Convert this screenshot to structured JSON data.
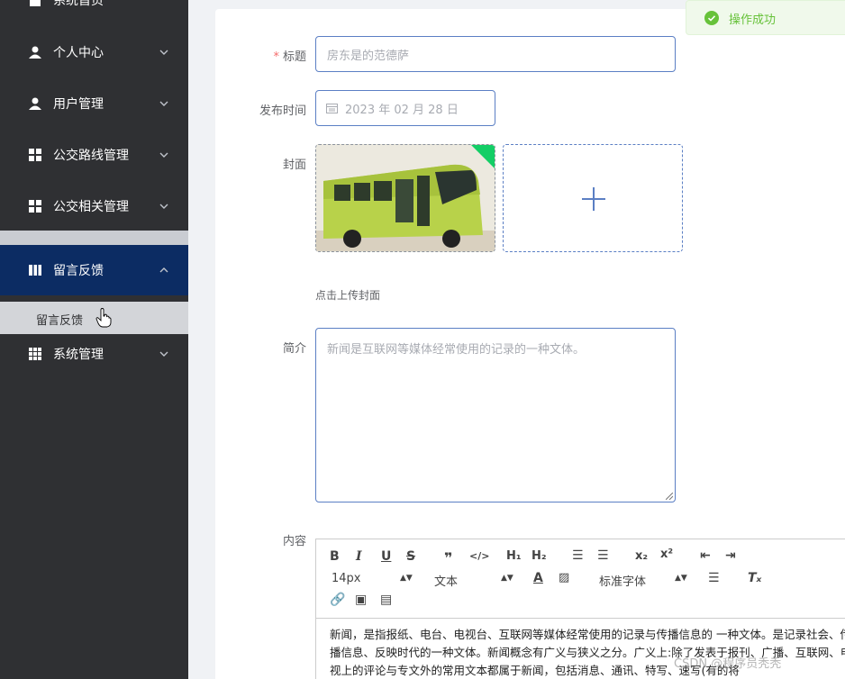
{
  "sidebar": {
    "items": [
      {
        "label": "系统首页",
        "icon": "home-icon"
      },
      {
        "label": "个人中心",
        "icon": "user-icon"
      },
      {
        "label": "用户管理",
        "icon": "user-icon"
      },
      {
        "label": "公交路线管理",
        "icon": "grid-icon"
      },
      {
        "label": "公交相关管理",
        "icon": "grid-icon"
      },
      {
        "label": "留言反馈",
        "icon": "book-icon"
      },
      {
        "label": "系统管理",
        "icon": "apps-icon"
      }
    ],
    "sub_items": [
      {
        "label": "留言反馈"
      }
    ]
  },
  "form": {
    "title": {
      "label": "标题",
      "required_mark": "*",
      "value": "房东是的范德萨"
    },
    "publish_time": {
      "label": "发布时间",
      "value": "2023 年 02 月 28 日"
    },
    "cover": {
      "label": "封面",
      "hint": "点击上传封面"
    },
    "summary": {
      "label": "简介",
      "value": "新闻是互联网等媒体经常使用的记录的一种文体。"
    },
    "content": {
      "label": "内容",
      "toolbar": {
        "font_size": "14px",
        "block_type": "文本",
        "font_family": "标准字体"
      },
      "text": "新闻，是指报纸、电台、电视台、互联网等媒体经常使用的记录与传播信息的 一种文体。是记录社会、传播信息、反映时代的一种文体。新闻概念有广义与狭义之分。广义上:除了发表于报刊、广播、互联网、电视上的评论与专文外的常用文本都属于新闻，包括消息、通讯、特写、速写(有的将"
    }
  },
  "toast": {
    "message": "操作成功"
  },
  "watermark": "CSDN @程序员秃秃",
  "colors": {
    "sidebar_bg": "#2f3033",
    "active_bg": "#0c2c63",
    "accent": "#5b7fc4",
    "success": "#67c23a"
  }
}
